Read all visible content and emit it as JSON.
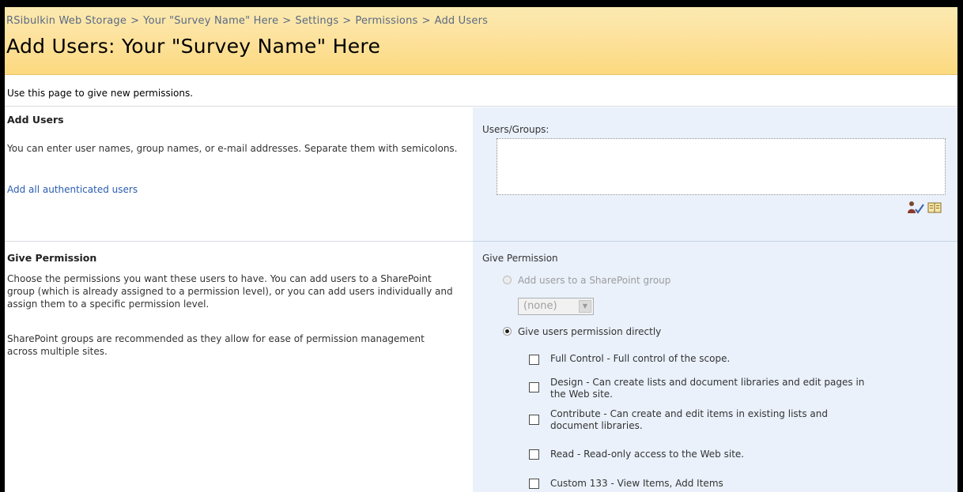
{
  "breadcrumb": {
    "items": [
      "RSibulkin Web Storage",
      "Your \"Survey Name\" Here",
      "Settings",
      "Permissions",
      "Add Users"
    ],
    "separator": ">"
  },
  "page_title": "Add Users: Your \"Survey Name\" Here",
  "intro_text": "Use this page to give new permissions.",
  "add_users": {
    "title": "Add Users",
    "description": "You can enter user names, group names, or e-mail addresses. Separate them with semicolons.",
    "link_text": "Add all authenticated users",
    "field_label": "Users/Groups:",
    "field_value": "",
    "check_names_icon": "check-names-icon",
    "browse_icon": "address-book-icon"
  },
  "give_permission": {
    "title": "Give Permission",
    "description_1": "Choose the permissions you want these users to have. You can add users to a SharePoint group (which is already assigned to a permission level), or you can add users individually and assign them to a specific permission level.",
    "description_2": "SharePoint groups are recommended as they allow for ease of permission management across multiple sites.",
    "group_label": "Give Permission",
    "option_group": "Add users to a SharePoint group",
    "group_select_value": "(none)",
    "option_direct": "Give users permission directly",
    "permissions": [
      {
        "label": "Full Control - Full control of the scope.",
        "checked": false
      },
      {
        "label": "Design - Can create lists and document libraries and edit pages in the Web site.",
        "checked": false
      },
      {
        "label": "Contribute - Can create and edit items in existing lists and document libraries.",
        "checked": false
      },
      {
        "label": "Read - Read-only access to the Web site.",
        "checked": false
      },
      {
        "label": "Custom 133 - View Items, Add Items",
        "checked": false
      }
    ]
  },
  "colors": {
    "title_band": "#fcd97f",
    "right_pane": "#eaf1fb",
    "link": "#2a5db0",
    "breadcrumb": "#5a6a85"
  }
}
